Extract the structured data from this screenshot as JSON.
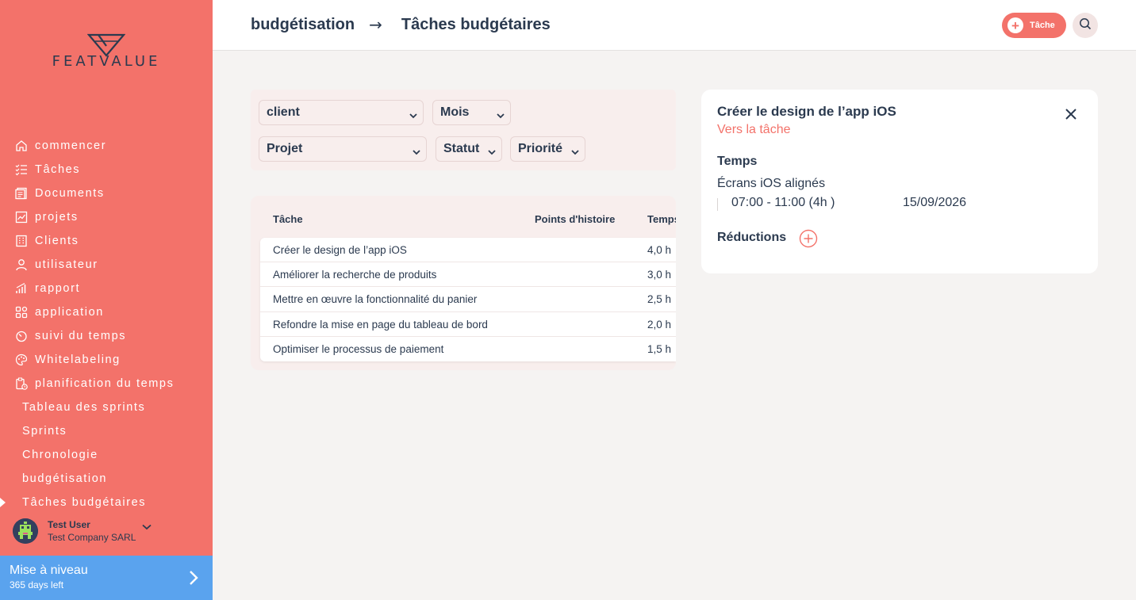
{
  "brand": {
    "logo_text": "FEATVALUE"
  },
  "sidebar": {
    "items": [
      {
        "label": "commencer",
        "icon": "home-icon"
      },
      {
        "label": "Tâches",
        "icon": "tasks-list-icon"
      },
      {
        "label": "Documents",
        "icon": "documents-icon"
      },
      {
        "label": "projets",
        "icon": "projects-chart-icon"
      },
      {
        "label": "Clients",
        "icon": "building-icon"
      },
      {
        "label": "utilisateur",
        "icon": "user-icon"
      },
      {
        "label": "rapport",
        "icon": "report-bars-icon"
      },
      {
        "label": "application",
        "icon": "apps-grid-icon"
      },
      {
        "label": "suivi du temps",
        "icon": "timer-icon"
      },
      {
        "label": "Whitelabeling",
        "icon": "palette-icon"
      },
      {
        "label": "planification du temps",
        "icon": "schedule-clipboard-icon"
      }
    ],
    "sub_items": [
      {
        "label": "Tableau des sprints"
      },
      {
        "label": "Sprints"
      },
      {
        "label": "Chronologie"
      },
      {
        "label": "budgétisation"
      },
      {
        "label": "Tâches budgétaires",
        "active": true
      }
    ],
    "user": {
      "name": "Test User",
      "company": "Test Company SARL"
    },
    "upgrade": {
      "title": "Mise à niveau",
      "subtitle": "365 days left"
    }
  },
  "header": {
    "breadcrumb_parent": "budgétisation",
    "breadcrumb_arrow": "→",
    "breadcrumb_current": "Tâches budgétaires",
    "new_task_label": "Tâche"
  },
  "filters": {
    "client": "client",
    "month": "Mois",
    "project": "Projet",
    "status": "Statut",
    "priority": "Priorité"
  },
  "table": {
    "headers": {
      "task": "Tâche",
      "story_points": "Points d'histoire",
      "time": "Temps"
    },
    "rows": [
      {
        "task": "Créer le design de l’app iOS",
        "points": "",
        "time": "4,0 h"
      },
      {
        "task": "Améliorer la recherche de produits",
        "points": "",
        "time": "3,0 h"
      },
      {
        "task": "Mettre en œuvre la fonctionnalité du panier",
        "points": "",
        "time": "2,5 h"
      },
      {
        "task": "Refondre la mise en page du tableau de bord",
        "points": "",
        "time": "2,0 h"
      },
      {
        "task": "Optimiser le processus de paiement",
        "points": "",
        "time": "1,5 h"
      }
    ]
  },
  "detail": {
    "title": "Créer le design de l’app iOS",
    "link": "Vers la tâche",
    "time_section": "Temps",
    "entry_title": "Écrans iOS alignés",
    "entry_time": "07:00 - 11:00 (4h )",
    "entry_date": "15/09/2026",
    "reductions_label": "Réductions"
  },
  "colors": {
    "accent": "#f3726a",
    "upgrade": "#5aa3ee",
    "text": "#2b3a4f"
  }
}
